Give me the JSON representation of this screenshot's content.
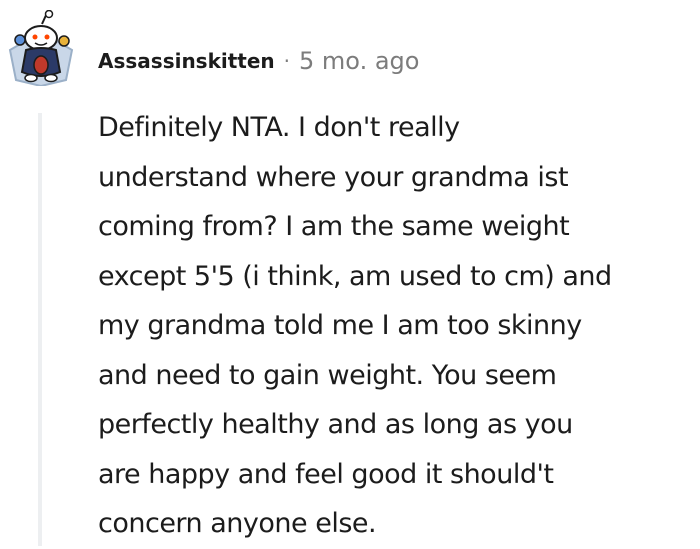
{
  "comment": {
    "author": "Assassinskitten",
    "separator": "·",
    "timestamp": "5 mo. ago",
    "avatar_icon": "reddit-snoo-avatar-icon",
    "body_lines": [
      "Definitely NTA. I don't really",
      "understand where your grandma ist",
      "coming from? I am the same weight",
      "except 5'5 (i think, am used to cm) and",
      "my grandma told me I am too skinny",
      "and need to gain weight. You seem",
      "perfectly healthy and as long as you",
      "are happy and feel good it should't",
      "concern anyone else."
    ]
  },
  "colors": {
    "text": "#1c1c1c",
    "meta": "#7c7c7c",
    "thread_line": "#edeff1",
    "avatar_bg": "#1a1a3a",
    "snoo": "#ffffff"
  }
}
